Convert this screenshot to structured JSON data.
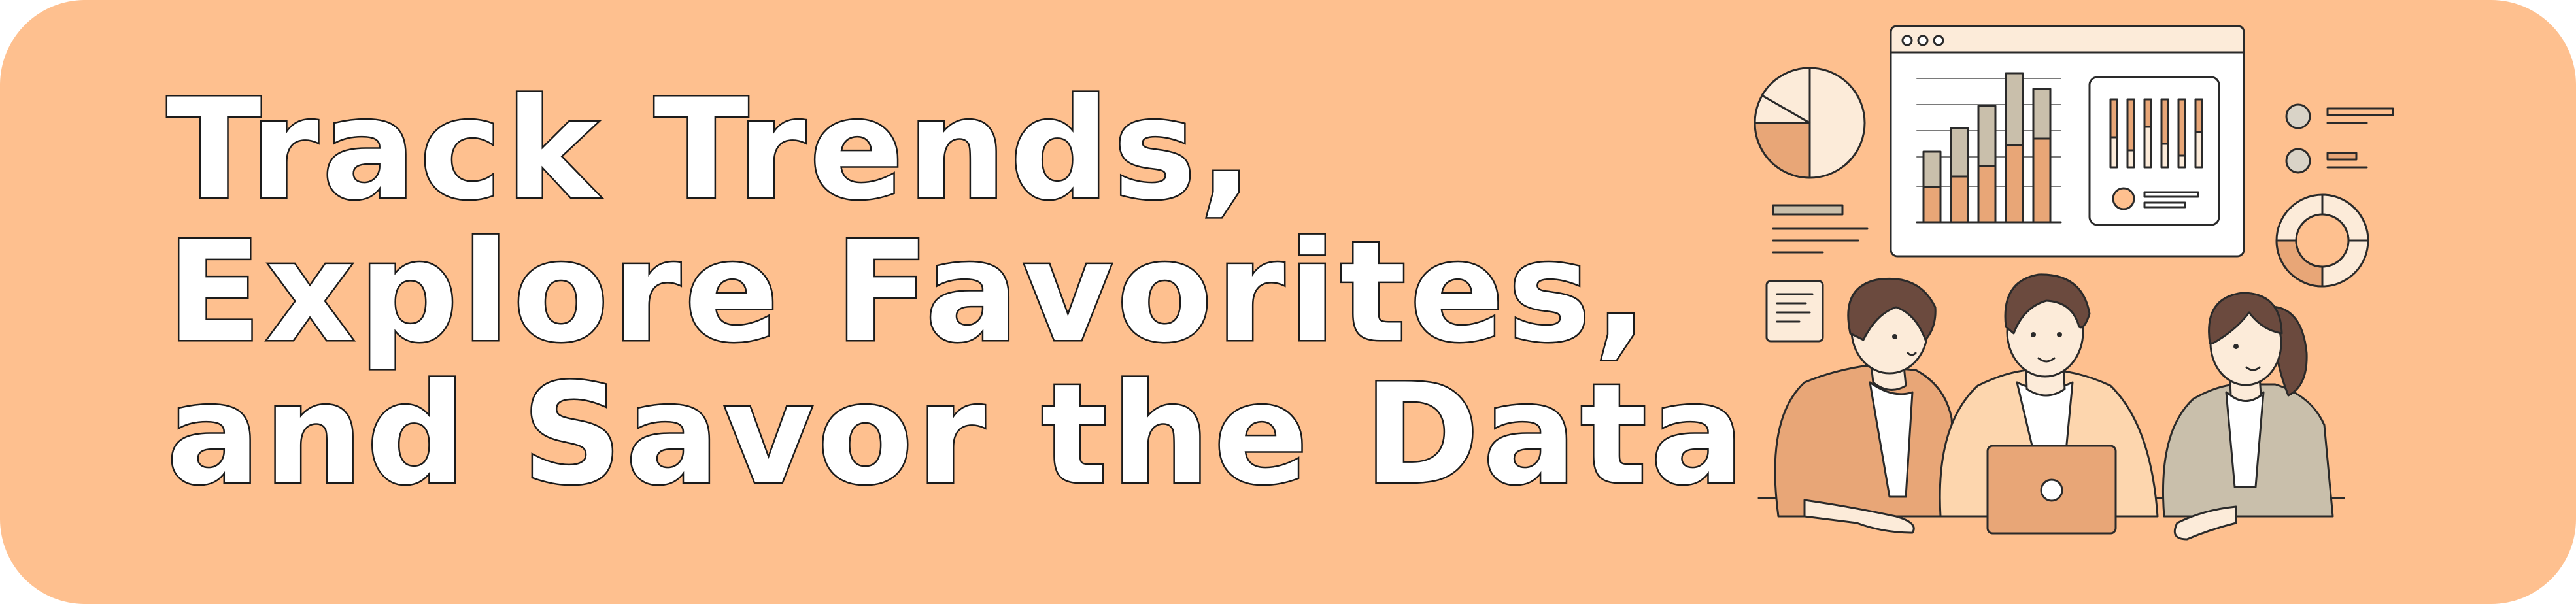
{
  "banner": {
    "headline_lines": [
      "Track Trends,",
      "Explore Favorites,",
      "and Savor the Data"
    ],
    "colors": {
      "background": "#fec08f",
      "text_fill": "#ffffff",
      "outline": "#1b1b1b",
      "chart_orange": "#e8a677",
      "chart_gray": "#c9bfab",
      "panel_cream": "#fcebd9"
    }
  },
  "illustration": {
    "icons": [
      "pie-chart-icon",
      "browser-window-icon",
      "bar-chart-icon",
      "slider-panel-icon",
      "donut-chart-icon",
      "document-note-icon",
      "laptop-icon"
    ],
    "people": [
      "person-left",
      "person-center",
      "person-right"
    ]
  }
}
